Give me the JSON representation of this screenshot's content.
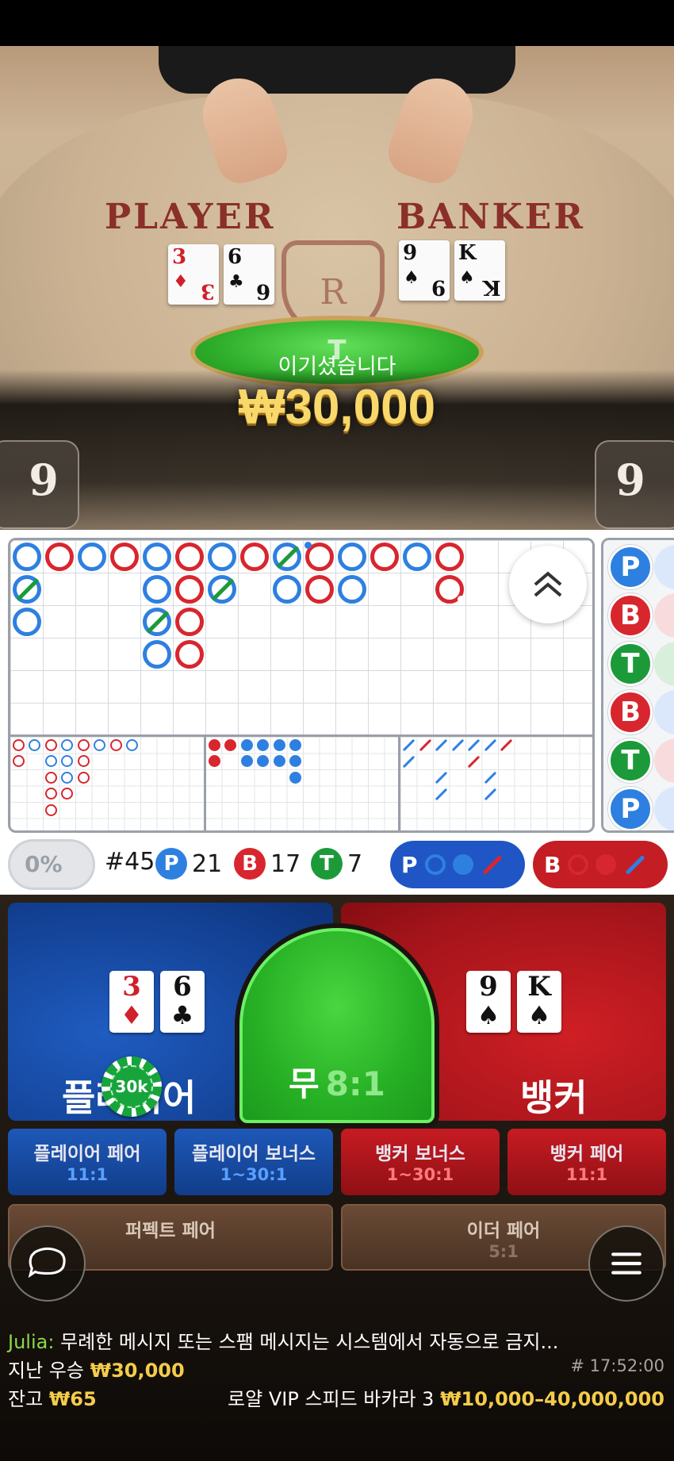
{
  "video": {
    "player_label": "PLAYER",
    "banker_label": "BANKER",
    "crest_letter": "R",
    "tie_marker": "T",
    "win_message": "이기셨습니다",
    "win_amount": "₩30,000",
    "player_score": "9",
    "banker_score": "9",
    "player_cards": [
      {
        "rank": "3",
        "suit": "♦",
        "color": "red"
      },
      {
        "rank": "6",
        "suit": "♣",
        "color": "black"
      }
    ],
    "banker_cards": [
      {
        "rank": "9",
        "suit": "♠",
        "color": "black"
      },
      {
        "rank": "K",
        "suit": "♠",
        "color": "black"
      }
    ]
  },
  "roadmap": {
    "bead_column": [
      "P",
      "B",
      "T",
      "B",
      "T",
      "P"
    ]
  },
  "stats": {
    "percent": "0%",
    "round": "#45",
    "player_label": "P",
    "player_count": "21",
    "banker_label": "B",
    "banker_count": "17",
    "tie_label": "T",
    "tie_count": "7",
    "player_predict_label": "P",
    "banker_predict_label": "B"
  },
  "bet": {
    "player_label": "플레이어",
    "banker_label": "뱅커",
    "tie_label": "무",
    "tie_odds": "8:1",
    "chip_value": "30k",
    "player_cards": [
      {
        "rank": "3",
        "suit": "♦"
      },
      {
        "rank": "6",
        "suit": "♣"
      }
    ],
    "banker_cards": [
      {
        "rank": "9",
        "suit": "♠"
      },
      {
        "rank": "K",
        "suit": "♠"
      }
    ],
    "side_bets": [
      {
        "label": "플레이어 페어",
        "odds": "11:1"
      },
      {
        "label": "플레이어 보너스",
        "odds": "1~30:1"
      },
      {
        "label": "뱅커 보너스",
        "odds": "1~30:1"
      },
      {
        "label": "뱅커 페어",
        "odds": "11:1"
      }
    ],
    "perfect_pair_label": "퍼펙트 페어",
    "either_pair_label": "이더 페어",
    "either_pair_odds": "5:1"
  },
  "footer": {
    "chat_user": "Julia:",
    "chat_message": "무례한 메시지 또는 스팸 메시지는 시스템에서 자동으로 금지...",
    "last_win_label": "지난 우승",
    "last_win_amount": "₩30,000",
    "round_id": "# 17:52:00",
    "balance_label": "잔고",
    "balance_amount": "₩65",
    "table_name": "로얄 VIP 스피드 바카라 3",
    "table_limits": "₩10,000–40,000,000"
  },
  "colors": {
    "player_blue": "#2e80e0",
    "banker_red": "#d8262e",
    "tie_green": "#1c9a3a",
    "gold": "#f4cc4a"
  }
}
